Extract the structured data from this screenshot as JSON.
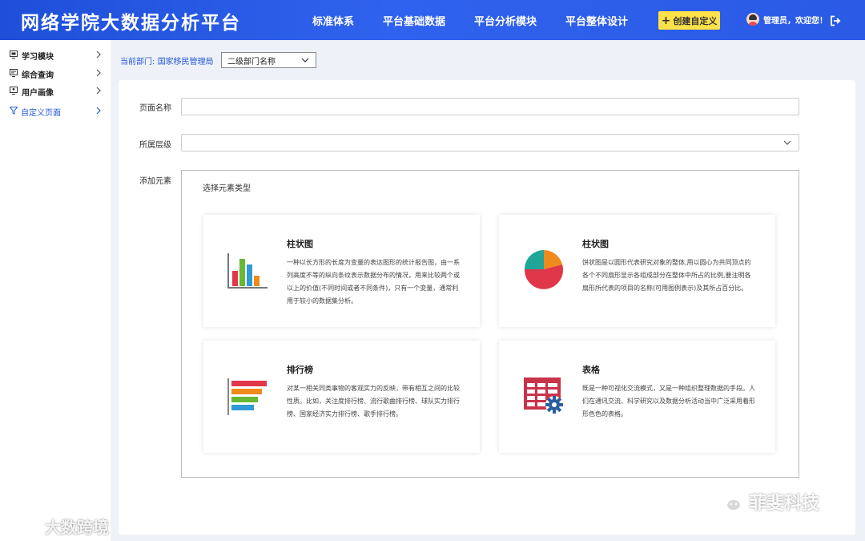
{
  "app": {
    "title": "网络学院大数据分析平台"
  },
  "topnav": {
    "items": [
      {
        "label": "标准体系"
      },
      {
        "label": "平台基础数据"
      },
      {
        "label": "平台分析模块"
      },
      {
        "label": "平台整体设计"
      }
    ],
    "create_button": "创建自定义",
    "user_greeting": "管理员，欢迎您！",
    "icons": {
      "create": "plus-icon",
      "avatar": "user-avatar-icon",
      "logout": "logout-icon"
    }
  },
  "sidebar": {
    "items": [
      {
        "label": "学习模块",
        "icon": "module-icon",
        "active": false
      },
      {
        "label": "综合查询",
        "icon": "query-icon",
        "active": false
      },
      {
        "label": "用户画像",
        "icon": "portrait-icon",
        "active": false
      },
      {
        "label": "自定义页面",
        "icon": "filter-icon",
        "active": true
      }
    ]
  },
  "breadcrumb": {
    "label": "当前部门:",
    "department": "国家移民管理局"
  },
  "dept_select": {
    "value": "二级部门名称"
  },
  "form": {
    "page_name_label": "页面名称",
    "page_name_value": "",
    "level_label": "所属层级",
    "level_value": "",
    "add_element_label": "添加元素",
    "element_type_title": "选择元素类型"
  },
  "cards": [
    {
      "title": "柱状图",
      "icon": "bar-chart-icon",
      "desc": "一种以长方形的长度为变量的表达图形的统计报告图，由一系列高度不等的纵向条纹表示数据分布的情况，用来比较两个或以上的价值(不同时间或者不同条件)，只有一个变量，通常利用于较小的数据集分析。"
    },
    {
      "title": "柱状图",
      "icon": "pie-chart-icon",
      "desc": "饼状图是以圆形代表研究对象的整体,用以圆心为共同顶点的各个不同扇形显示各组成部分在整体中所占的比例,要注明各扇形所代表的项目的名称(可用图例表示)及其所占百分比。"
    },
    {
      "title": "排行榜",
      "icon": "ranking-icon",
      "desc": "对某一相关同类事物的客观实力的反映，带有相互之间的比较性质。比如，关注度排行榜、流行歌曲排行榜、球队实力排行榜、国家经济实力排行榜、歌手排行榜。"
    },
    {
      "title": "表格",
      "icon": "table-settings-icon",
      "desc": "既是一种可视化交流模式，又是一种组织整理数据的手段。人们在通讯交流、科学研究以及数据分析活动当中广泛采用着形形色色的表格。"
    }
  ],
  "colors": {
    "header": "#2a5ae6",
    "accent": "#2459d8",
    "create_button": "#ffe14a"
  },
  "watermarks": {
    "left": "大数跨境",
    "right": "菲斐科技"
  }
}
